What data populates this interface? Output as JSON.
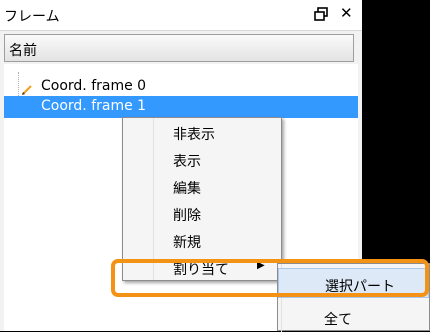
{
  "panel": {
    "title": "フレーム",
    "column_header": "名前",
    "items": [
      {
        "label": "Coord. frame 0",
        "selected": false
      },
      {
        "label": "Coord. frame 1",
        "selected": true
      }
    ]
  },
  "context_menu": {
    "items": [
      {
        "label": "非表示"
      },
      {
        "label": "表示"
      },
      {
        "label": "編集"
      },
      {
        "label": "削除"
      },
      {
        "label": "新規"
      },
      {
        "label": "割り当て",
        "has_submenu": true
      }
    ]
  },
  "submenu": {
    "items": [
      {
        "label": "選択パート"
      },
      {
        "label": "全て"
      }
    ]
  },
  "colors": {
    "selection": "#3399ff",
    "highlight": "#f39214",
    "background": "#000000"
  }
}
